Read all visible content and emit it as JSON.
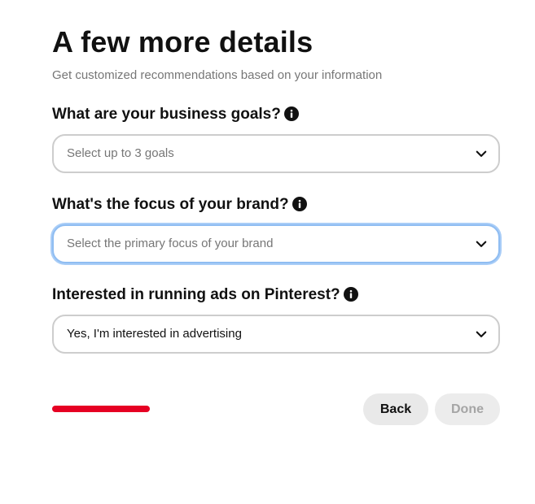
{
  "header": {
    "title": "A few more details",
    "subtitle": "Get customized recommendations based on your information"
  },
  "fields": [
    {
      "label": "What are your business goals?",
      "placeholder": "Select up to 3 goals",
      "value": ""
    },
    {
      "label": "What's the focus of your brand?",
      "placeholder": "Select the primary focus of your brand",
      "value": ""
    },
    {
      "label": "Interested in running ads on Pinterest?",
      "placeholder": "",
      "value": "Yes, I'm interested in advertising"
    }
  ],
  "progress": {
    "fraction": 1.0
  },
  "footer": {
    "back_label": "Back",
    "done_label": "Done"
  },
  "colors": {
    "brand_red": "#e60023",
    "focus_ring": "#8fbdf2",
    "muted_text": "#767676"
  },
  "icons": {
    "info": "info-icon",
    "chevron": "chevron-down-icon"
  }
}
